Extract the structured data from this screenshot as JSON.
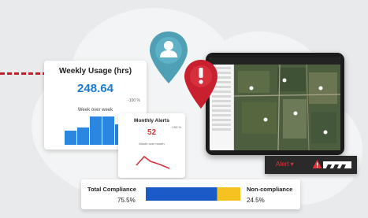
{
  "weekly_usage": {
    "title": "Weekly Usage (hrs)",
    "value": "248.64",
    "change": "-100 %",
    "subtitle": "Week over week"
  },
  "monthly_alerts": {
    "title": "Monthly Alerts",
    "change": "-100 %",
    "value": "52",
    "subtitle": "Month over month"
  },
  "compliance": {
    "total_label": "Total Compliance",
    "total_value": "75.5%",
    "non_label": "Non-compliance",
    "non_value": "24.5%",
    "total_fraction": 0.755
  },
  "alert_strip": {
    "label": "Alert ▾"
  },
  "colors": {
    "accent_blue": "#1a7bd4",
    "alert_red": "#d0353a",
    "compliance_yellow": "#f4c322",
    "user_pin": "#4fa0b5",
    "alert_pin": "#c8202f"
  }
}
